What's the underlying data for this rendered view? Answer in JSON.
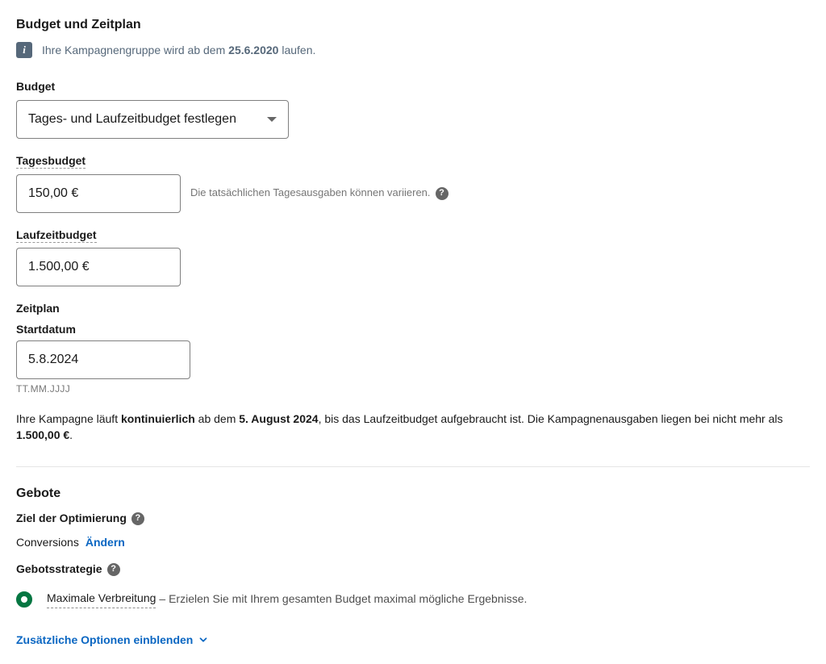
{
  "header": {
    "title": "Budget und Zeitplan"
  },
  "info": {
    "prefix": "Ihre Kampagnengruppe wird ab dem ",
    "date": "25.6.2020",
    "suffix": " laufen."
  },
  "budget": {
    "label": "Budget",
    "select_value": "Tages- und Laufzeitbudget festlegen",
    "daily": {
      "label": "Tagesbudget",
      "value": "150,00 €",
      "hint": "Die tatsächlichen Tagesausgaben können variieren."
    },
    "lifetime": {
      "label": "Laufzeitbudget",
      "value": "1.500,00 €"
    }
  },
  "schedule": {
    "label": "Zeitplan",
    "start_label": "Startdatum",
    "start_value": "5.8.2024",
    "format_hint": "TT.MM.JJJJ"
  },
  "summary": {
    "part1": "Ihre Kampagne läuft ",
    "bold1": "kontinuierlich",
    "part2": " ab dem ",
    "bold2": "5. August 2024",
    "part3": ", bis das Laufzeitbudget aufgebraucht ist. Die Kampagnenausgaben liegen bei nicht mehr als ",
    "bold3": "1.500,00 €",
    "part4": "."
  },
  "bids": {
    "title": "Gebote",
    "goal": {
      "label": "Ziel der Optimierung",
      "value": "Conversions",
      "change": "Ändern"
    },
    "strategy": {
      "label": "Gebotsstrategie",
      "option_label": "Maximale Verbreitung",
      "option_desc": "– Erzielen Sie mit Ihrem gesamten Budget maximal mögliche Ergebnisse."
    },
    "more": "Zusätzliche Optionen einblenden"
  }
}
